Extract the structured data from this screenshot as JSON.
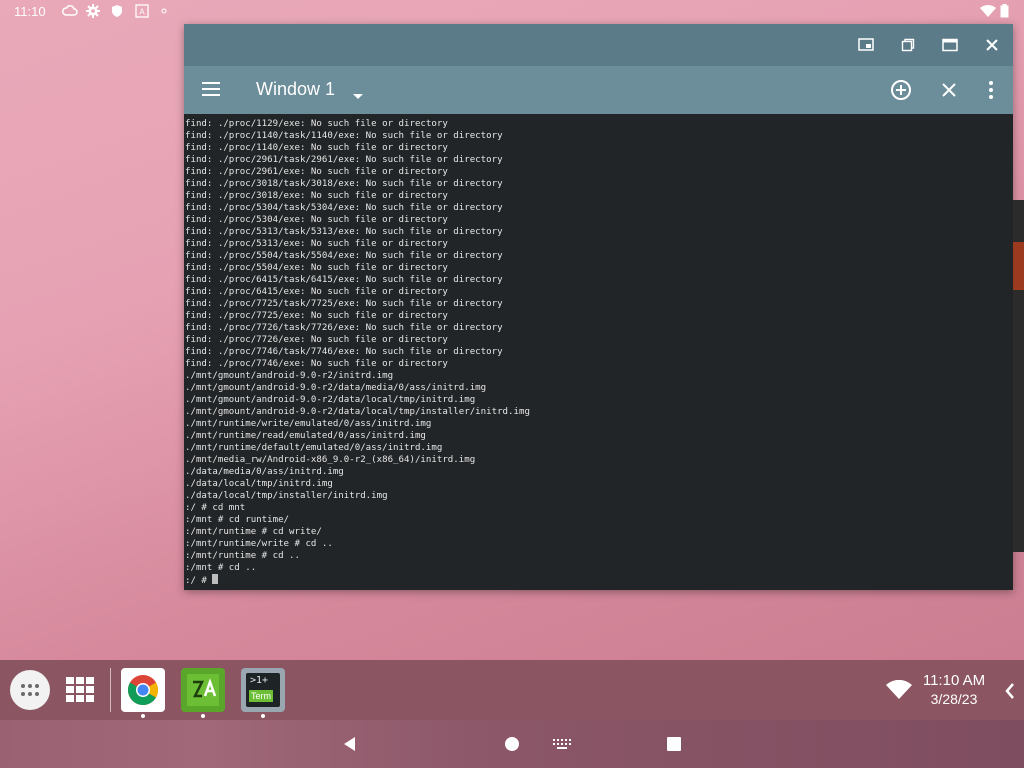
{
  "status_bar": {
    "time": "11:10",
    "icons": [
      "cloud-icon",
      "gear-icon",
      "shield-icon",
      "a-icon",
      "dot-icon",
      "wifi-icon",
      "battery-icon"
    ]
  },
  "window": {
    "title": "Window 1",
    "caption_buttons": [
      "pip-icon",
      "restore-icon",
      "maximize-icon",
      "close-icon"
    ],
    "toolbar_buttons": [
      "menu-icon",
      "dropdown-caret-icon",
      "add-circle-icon",
      "close-icon",
      "more-vert-icon"
    ]
  },
  "terminal": {
    "lines": [
      "find: ./proc/1129/exe: No such file or directory",
      "find: ./proc/1140/task/1140/exe: No such file or directory",
      "find: ./proc/1140/exe: No such file or directory",
      "find: ./proc/2961/task/2961/exe: No such file or directory",
      "find: ./proc/2961/exe: No such file or directory",
      "find: ./proc/3018/task/3018/exe: No such file or directory",
      "find: ./proc/3018/exe: No such file or directory",
      "find: ./proc/5304/task/5304/exe: No such file or directory",
      "find: ./proc/5304/exe: No such file or directory",
      "find: ./proc/5313/task/5313/exe: No such file or directory",
      "find: ./proc/5313/exe: No such file or directory",
      "find: ./proc/5504/task/5504/exe: No such file or directory",
      "find: ./proc/5504/exe: No such file or directory",
      "find: ./proc/6415/task/6415/exe: No such file or directory",
      "find: ./proc/6415/exe: No such file or directory",
      "find: ./proc/7725/task/7725/exe: No such file or directory",
      "find: ./proc/7725/exe: No such file or directory",
      "find: ./proc/7726/task/7726/exe: No such file or directory",
      "find: ./proc/7726/exe: No such file or directory",
      "find: ./proc/7746/task/7746/exe: No such file or directory",
      "find: ./proc/7746/exe: No such file or directory",
      "./mnt/gmount/android-9.0-r2/initrd.img",
      "./mnt/gmount/android-9.0-r2/data/media/0/ass/initrd.img",
      "./mnt/gmount/android-9.0-r2/data/local/tmp/initrd.img",
      "./mnt/gmount/android-9.0-r2/data/local/tmp/installer/initrd.img",
      "./mnt/runtime/write/emulated/0/ass/initrd.img",
      "./mnt/runtime/read/emulated/0/ass/initrd.img",
      "./mnt/runtime/default/emulated/0/ass/initrd.img",
      "./mnt/media_rw/Android-x86_9.0-r2_(x86_64)/initrd.img",
      "./data/media/0/ass/initrd.img",
      "./data/local/tmp/initrd.img",
      "./data/local/tmp/installer/initrd.img",
      ":/ # cd mnt",
      ":/mnt # cd runtime/",
      ":/mnt/runtime # cd write/",
      ":/mnt/runtime/write # cd ..",
      ":/mnt/runtime # cd ..",
      ":/mnt # cd ..",
      ":/ # "
    ]
  },
  "taskbar": {
    "apps": [
      {
        "name": "chrome-app",
        "icon": "chrome-icon"
      },
      {
        "name": "zarchiver-app",
        "icon": "zarchiver-icon"
      },
      {
        "name": "terminal-app",
        "icon": "terminal-icon",
        "label": ">1+",
        "sublabel": "Term"
      }
    ],
    "clock_time": "11:10 AM",
    "clock_date": "3/28/23"
  },
  "colors": {
    "caption_bar": "#5b7b88",
    "toolbar": "#6c8d9a",
    "terminal_bg": "#222527",
    "taskbar": "#8b5562"
  }
}
